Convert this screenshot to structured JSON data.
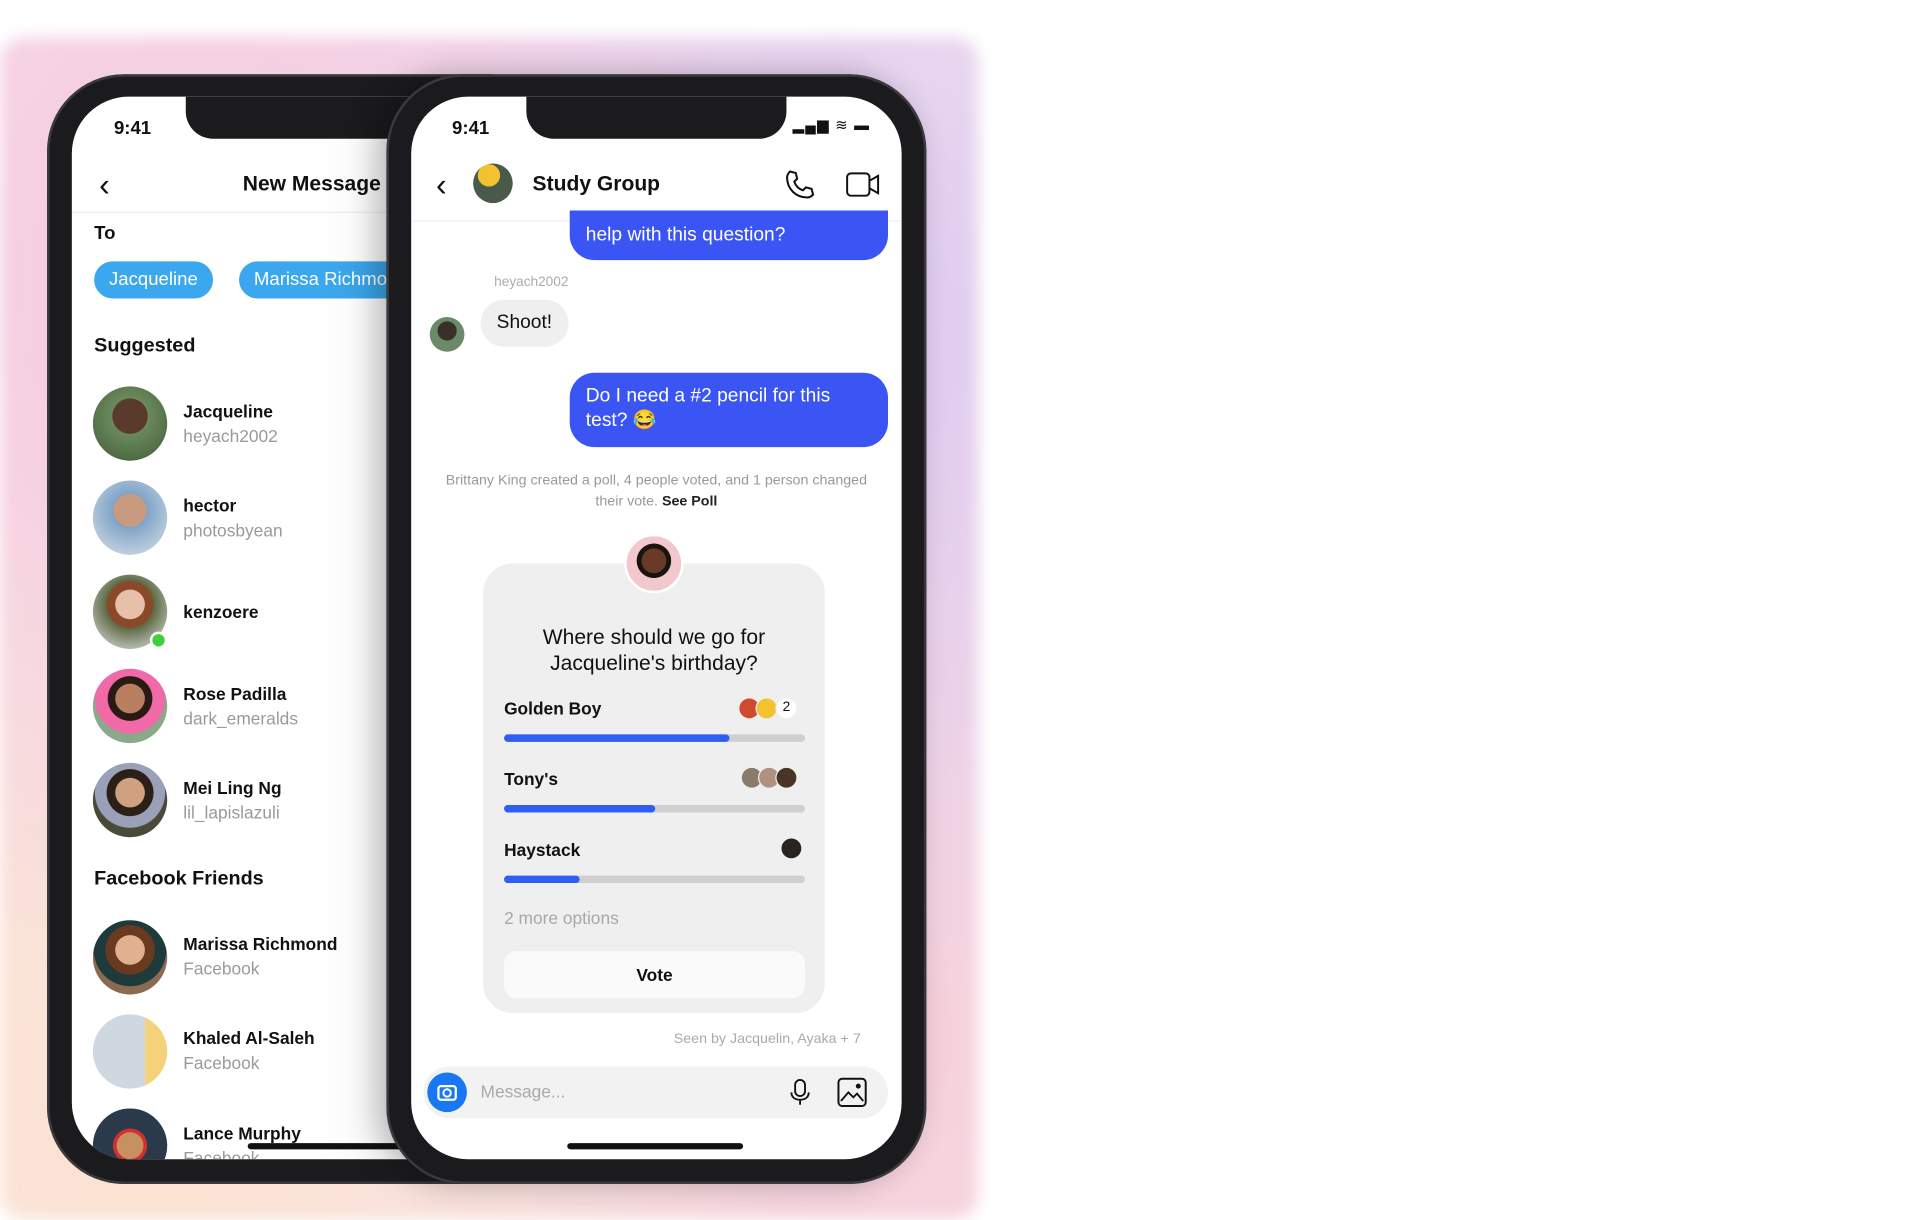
{
  "back_phone": {
    "status_time": "9:41",
    "title": "New Message",
    "to_label": "To",
    "chips": [
      "Jacqueline",
      "Marissa Richmond"
    ],
    "suggested_heading": "Suggested",
    "suggested": [
      {
        "name": "Jacqueline",
        "username": "heyach2002"
      },
      {
        "name": "hector",
        "username": "photosbyean"
      },
      {
        "name": "kenzoere",
        "username": "",
        "online": true
      },
      {
        "name": "Rose Padilla",
        "username": "dark_emeralds"
      },
      {
        "name": "Mei Ling Ng",
        "username": "lil_lapislazuli"
      }
    ],
    "facebook_heading": "Facebook Friends",
    "facebook_friends": [
      {
        "name": "Marissa Richmond",
        "source": "Facebook"
      },
      {
        "name": "Khaled Al-Saleh",
        "source": "Facebook"
      },
      {
        "name": "Lance Murphy",
        "source": "Facebook"
      }
    ]
  },
  "front_phone": {
    "status_time": "9:41",
    "chat_title": "Study Group",
    "messages": {
      "outgoing_partial": "help with this question?",
      "sender_label": "heyach2002",
      "incoming": "Shoot!",
      "outgoing": "Do I need a #2 pencil for this test? 😂"
    },
    "system_notice": "Brittany King created a poll, 4 people voted, and 1 person changed their vote.",
    "system_link": "See Poll",
    "poll": {
      "question": "Where should we go for Jacqueline's birthday?",
      "options": [
        {
          "label": "Golden Boy",
          "fraction": 0.75,
          "extra_count": "2"
        },
        {
          "label": "Tony's",
          "fraction": 0.5
        },
        {
          "label": "Haystack",
          "fraction": 0.25
        }
      ],
      "more_options": "2 more options",
      "vote_label": "Vote"
    },
    "seen_by": "Seen by Jacquelin, Ayaka + 7",
    "composer_placeholder": "Message...",
    "colors": {
      "accent": "#3b55f5",
      "chip": "#3aa7ee",
      "camera": "#1877f2"
    }
  }
}
